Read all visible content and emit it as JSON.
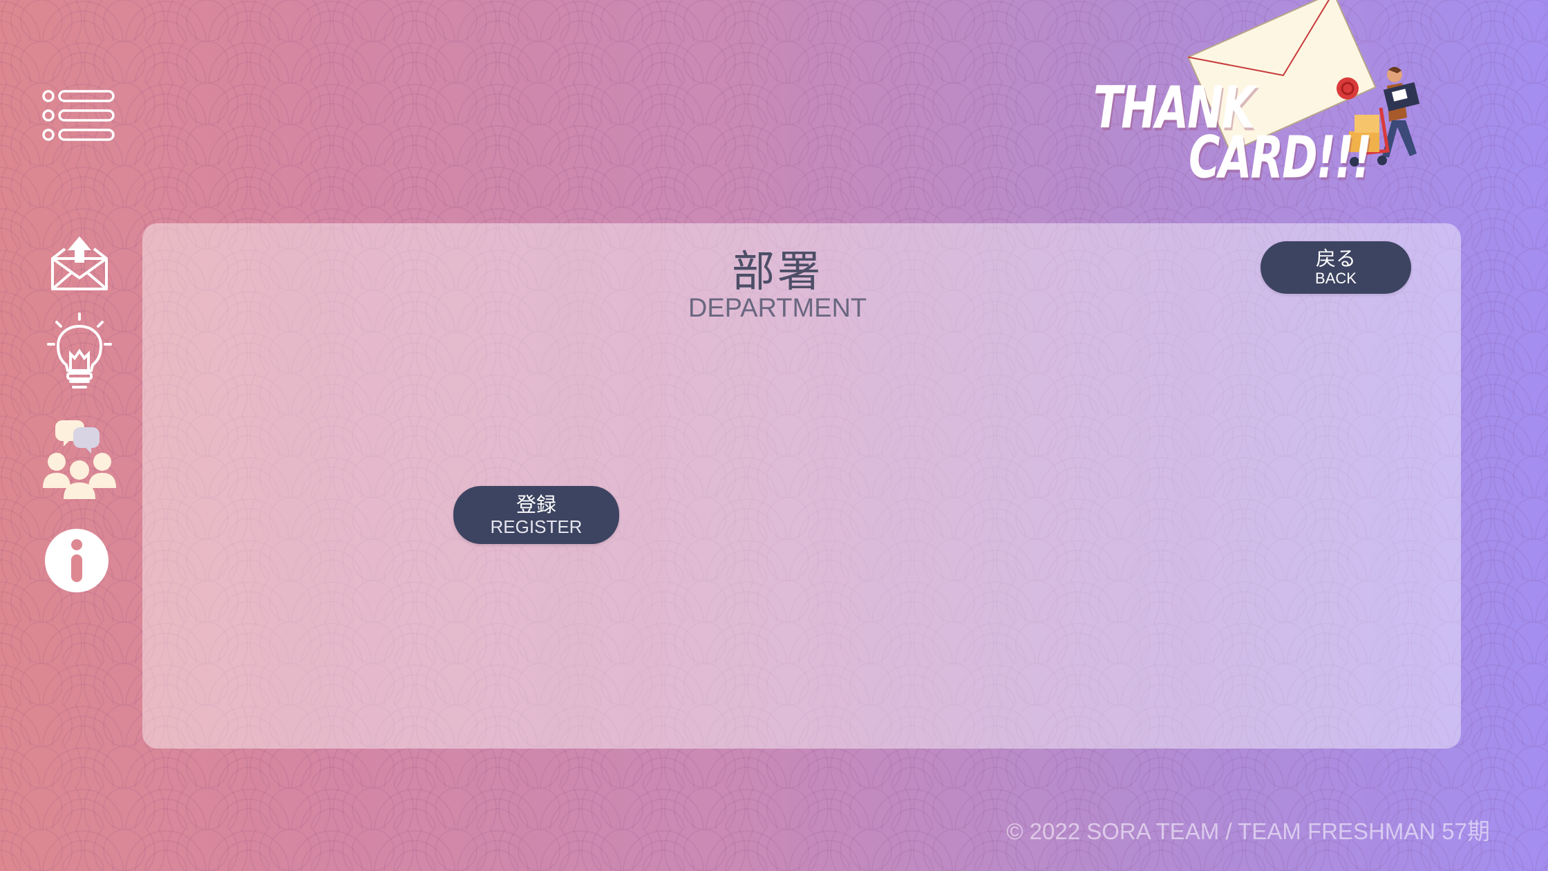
{
  "logo": {
    "line1": "THANK",
    "line2": "CARD!!!"
  },
  "sidebar": {
    "items": [
      {
        "icon": "menu-list-icon"
      },
      {
        "icon": "send-mail-icon"
      },
      {
        "icon": "lightbulb-icon"
      },
      {
        "icon": "team-chat-icon"
      },
      {
        "icon": "info-icon"
      }
    ]
  },
  "panel": {
    "title_jp": "部署",
    "title_en": "DEPARTMENT"
  },
  "back_button": {
    "jp": "戻る",
    "en": "BACK"
  },
  "register_button": {
    "jp": "登録",
    "en": "REGISTER"
  },
  "footer": {
    "text": "© 2022 SORA TEAM / TEAM FRESHMAN 57期"
  },
  "colors": {
    "gradient_left": "#dd8890",
    "gradient_right": "#a38ef0",
    "button": "#3d4461",
    "title": "#4d4e67",
    "icon": "#ffffff",
    "icon_cream": "#fdf0dc"
  }
}
